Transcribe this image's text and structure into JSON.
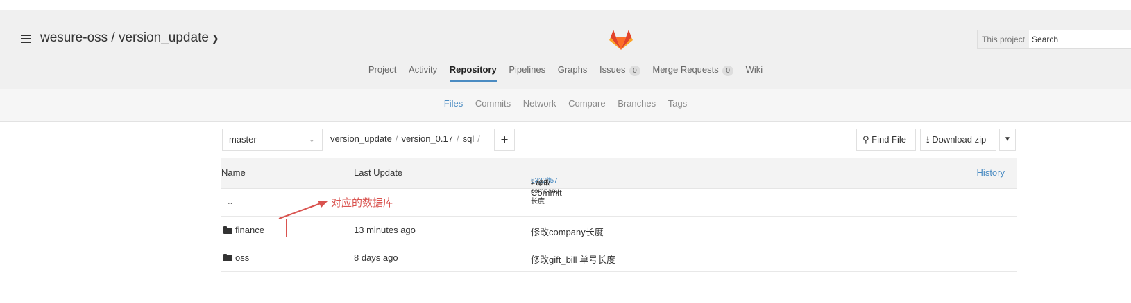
{
  "header": {
    "project_title": "wesure-oss / version_update",
    "search_scope": "This project",
    "search_placeholder": "Search"
  },
  "main_nav": [
    {
      "label": "Project"
    },
    {
      "label": "Activity"
    },
    {
      "label": "Repository",
      "active": true
    },
    {
      "label": "Pipelines"
    },
    {
      "label": "Graphs"
    },
    {
      "label": "Issues",
      "badge": "0"
    },
    {
      "label": "Merge Requests",
      "badge": "0"
    },
    {
      "label": "Wiki"
    }
  ],
  "sub_nav": [
    {
      "label": "Files",
      "active": true
    },
    {
      "label": "Commits"
    },
    {
      "label": "Network"
    },
    {
      "label": "Compare"
    },
    {
      "label": "Branches"
    },
    {
      "label": "Tags"
    }
  ],
  "toolbar": {
    "branch": "master",
    "breadcrumb": [
      "version_update",
      "version_0.17",
      "sql"
    ],
    "plus": "+",
    "find_file": "Find File",
    "download_zip": "Download zip"
  },
  "table": {
    "headers": {
      "name": "Name",
      "last_update": "Last Update",
      "last_commit": "Last Commit",
      "commit_hash": "6322ff57",
      "commit_message": "– 修改company长度",
      "history": "History"
    },
    "parent_dir": "..",
    "rows": [
      {
        "name": "finance",
        "last_update": "13 minutes ago",
        "commit_message": "修改company长度"
      },
      {
        "name": "oss",
        "last_update": "8 days ago",
        "commit_message": "修改gift_bill 单号长度"
      }
    ]
  },
  "annotation": {
    "text": "对应的数据库",
    "color": "#d9534f"
  },
  "colors": {
    "accent": "#4a8bc2",
    "logo_orange": "#e2432a"
  }
}
